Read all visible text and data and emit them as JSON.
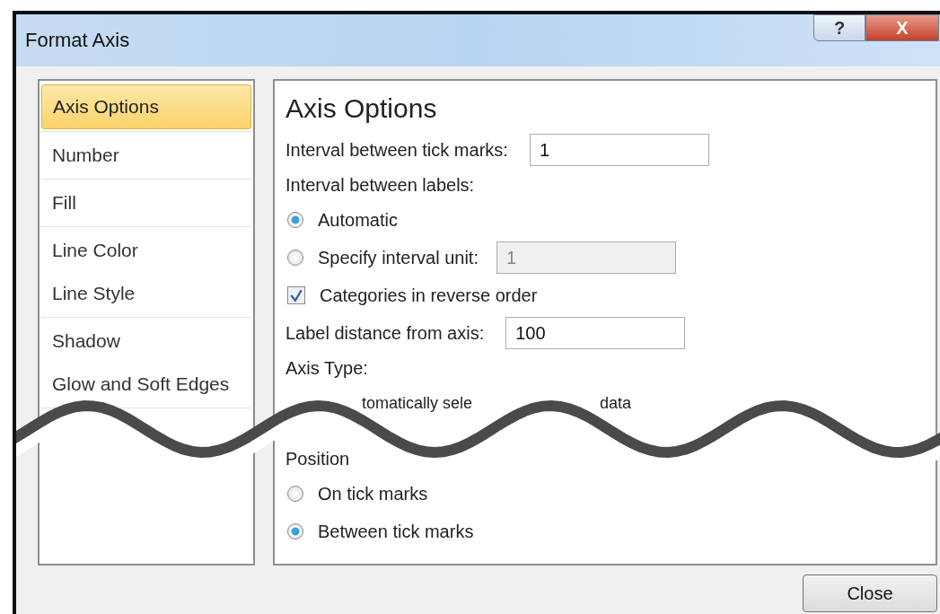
{
  "window": {
    "title": "Format Axis",
    "help_button": "?",
    "close_button": "X"
  },
  "sidebar": {
    "groups": [
      [
        {
          "label": "Axis Options",
          "selected": true
        }
      ],
      [
        {
          "label": "Number",
          "selected": false
        }
      ],
      [
        {
          "label": "Fill",
          "selected": false
        }
      ],
      [
        {
          "label": "Line Color",
          "selected": false
        },
        {
          "label": "Line Style",
          "selected": false
        }
      ],
      [
        {
          "label": "Shadow",
          "selected": false
        },
        {
          "label": "Glow and Soft Edges",
          "selected": false
        }
      ]
    ]
  },
  "panel": {
    "heading": "Axis Options",
    "rows_above": [
      {
        "kind": "field",
        "label": "Interval between tick marks:",
        "value": "1",
        "disabled": false
      },
      {
        "kind": "label",
        "label": "Interval between labels:"
      },
      {
        "kind": "radio",
        "label": "Automatic",
        "selected": true
      },
      {
        "kind": "radio_field",
        "label": "Specify interval unit:",
        "selected": false,
        "value": "1",
        "disabled": true
      },
      {
        "kind": "checkbox",
        "label": "Categories in reverse order",
        "checked": true
      },
      {
        "kind": "field",
        "label": "Label distance from axis:",
        "value": "100",
        "disabled": false
      },
      {
        "kind": "label",
        "label": "Axis Type:"
      },
      {
        "kind": "fragments",
        "parts": [
          "tomatically sele",
          "data"
        ]
      }
    ],
    "rows_below": [
      {
        "kind": "label",
        "label": "Position"
      },
      {
        "kind": "radio",
        "label": "On tick marks",
        "selected": false
      },
      {
        "kind": "radio",
        "label": "Between tick marks",
        "selected": true
      }
    ]
  },
  "buttons": [
    "Close"
  ]
}
